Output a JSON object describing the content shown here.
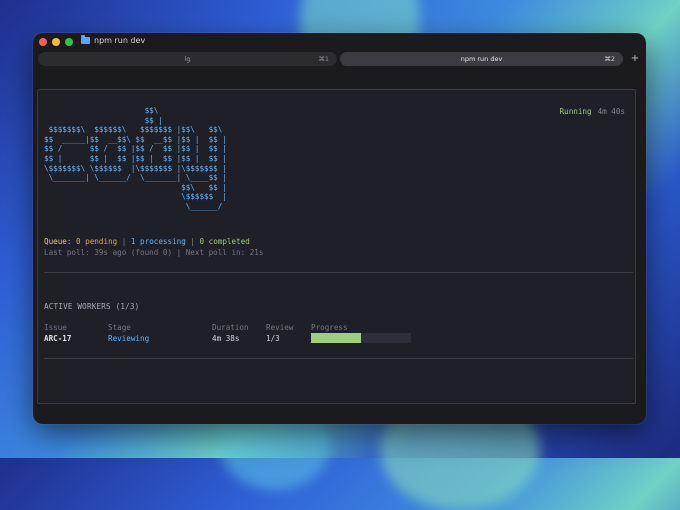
{
  "window": {
    "title": "npm run dev"
  },
  "tabs": [
    {
      "label": "lg",
      "shortcut": "⌘1",
      "active": false
    },
    {
      "label": "npm run dev",
      "shortcut": "⌘2",
      "active": true
    }
  ],
  "new_tab_label": "+",
  "status": {
    "state": "Running",
    "elapsed": "4m 40s",
    "color": "#9ecf7a"
  },
  "logo_ascii": "                      $$\\\n                      $$ |\n $$$$$$$\\  $$$$$$\\   $$$$$$$ |$$\\   $$\\\n$$  _____|$$  __$$\\ $$  __$$ |$$ |  $$ |\n$$ /      $$ /  $$ |$$ /  $$ |$$ |  $$ |\n$$ |      $$ |  $$ |$$ |  $$ |$$ |  $$ |\n\\$$$$$$$\\ \\$$$$$$  |\\$$$$$$$ |\\$$$$$$$ |\n \\_______| \\______/  \\_______| \\____$$ |\n                              $$\\   $$ |\n                              \\$$$$$$  |\n                               \\______/",
  "queue": {
    "label": "Queue:",
    "pending": "0 pending",
    "processing": "1 processing",
    "completed": "0 completed",
    "separator": "|"
  },
  "poll": {
    "text": "Last poll: 39s ago (found 0) | Next poll in: 21s"
  },
  "workers": {
    "title": "ACTIVE WORKERS (1/3)",
    "columns": [
      "Issue",
      "Stage",
      "Duration",
      "Review",
      "Progress"
    ],
    "rows": [
      {
        "issue": "ARC-17",
        "stage": "Reviewing",
        "duration": "4m 38s",
        "review": "1/3",
        "progress": 0.5
      }
    ]
  },
  "colors": {
    "accent_blue": "#62b8ff",
    "accent_green": "#9ecf7a",
    "accent_yellow": "#e8c97a",
    "terminal_bg": "#1e1f27"
  },
  "icons": {
    "title_icon": "folder-icon"
  }
}
